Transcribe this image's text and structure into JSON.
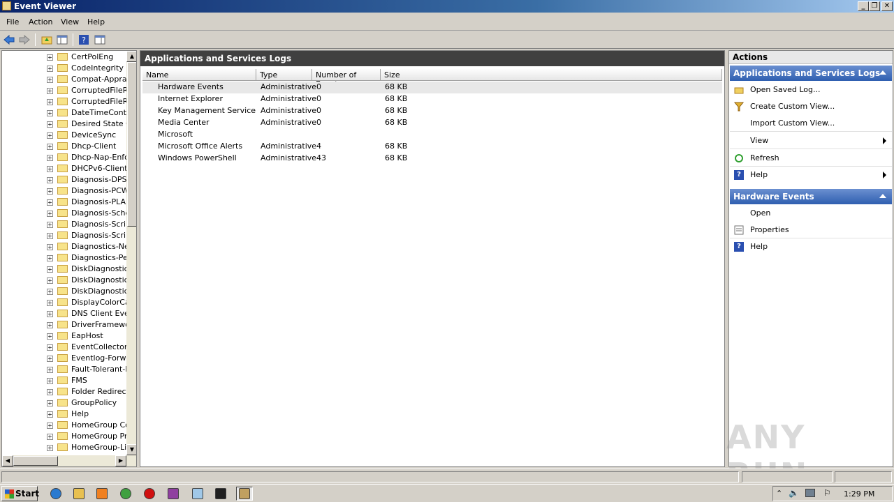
{
  "window": {
    "title": "Event Viewer",
    "minimize_label": "_",
    "maximize_label": "❐",
    "close_label": "✕"
  },
  "menu": [
    "File",
    "Action",
    "View",
    "Help"
  ],
  "tree": {
    "items": [
      "CertPolEng",
      "CodeIntegrity",
      "Compat-Apprais",
      "CorruptedFileRe",
      "CorruptedFileRe",
      "DateTimeContro",
      "Desired State Co",
      "DeviceSync",
      "Dhcp-Client",
      "Dhcp-Nap-Enfor",
      "DHCPv6-Client",
      "Diagnosis-DPS",
      "Diagnosis-PCW",
      "Diagnosis-PLA",
      "Diagnosis-Sched",
      "Diagnosis-Script",
      "Diagnosis-Script",
      "Diagnostics-Netw",
      "Diagnostics-Perf",
      "DiskDiagnostic",
      "DiskDiagnosticDa",
      "DiskDiagnosticRe",
      "DisplayColorCalil",
      "DNS Client Even",
      "DriverFramewor",
      "EapHost",
      "EventCollector",
      "Eventlog-Forwar",
      "Fault-Tolerant-H",
      "FMS",
      "Folder Redirectic",
      "GroupPolicy",
      "Help",
      "HomeGroup Con",
      "HomeGroup Prov",
      "HomeGroup-Liste"
    ],
    "expander": "+"
  },
  "center": {
    "header": "Applications and Services Logs",
    "columns": [
      "Name",
      "Type",
      "Number of Events",
      "Size"
    ],
    "rows": [
      {
        "name": "Hardware Events",
        "type": "Administrative",
        "count": "0",
        "size": "68 KB"
      },
      {
        "name": "Internet Explorer",
        "type": "Administrative",
        "count": "0",
        "size": "68 KB"
      },
      {
        "name": "Key Management Service",
        "type": "Administrative",
        "count": "0",
        "size": "68 KB"
      },
      {
        "name": "Media Center",
        "type": "Administrative",
        "count": "0",
        "size": "68 KB"
      },
      {
        "name": "Microsoft",
        "type": "",
        "count": "",
        "size": ""
      },
      {
        "name": "Microsoft Office Alerts",
        "type": "Administrative",
        "count": "4",
        "size": "68 KB"
      },
      {
        "name": "Windows PowerShell",
        "type": "Administrative",
        "count": "43",
        "size": "68 KB"
      }
    ]
  },
  "actions": {
    "title": "Actions",
    "section1": {
      "title": "Applications and Services Logs",
      "items": [
        {
          "label": "Open Saved Log...",
          "icon": "open-folder-icon"
        },
        {
          "label": "Create Custom View...",
          "icon": "filter-icon"
        },
        {
          "label": "Import Custom View...",
          "icon": ""
        },
        {
          "label": "View",
          "icon": "",
          "submenu": true
        },
        {
          "label": "Refresh",
          "icon": "refresh-icon"
        },
        {
          "label": "Help",
          "icon": "help-icon",
          "submenu": true
        }
      ]
    },
    "section2": {
      "title": "Hardware Events",
      "items": [
        {
          "label": "Open",
          "icon": ""
        },
        {
          "label": "Properties",
          "icon": "properties-icon"
        },
        {
          "label": "Help",
          "icon": "help-icon"
        }
      ]
    }
  },
  "taskbar": {
    "start_label": "Start",
    "clock": "1:29 PM",
    "apps": [
      "internet-explorer-icon",
      "explorer-folder-icon",
      "media-player-icon",
      "chrome-icon",
      "opera-icon",
      "winrar-icon",
      "notepad-icon",
      "cmd-icon",
      "event-viewer-icon"
    ]
  },
  "watermark": "ANY RUN",
  "colors": {
    "header_dark": "#404040",
    "section_blue": "#2f5fb0",
    "title_blue": "#0a246a"
  }
}
